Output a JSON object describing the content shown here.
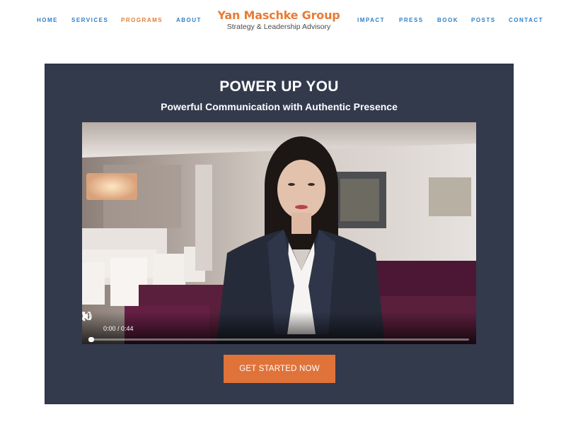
{
  "header": {
    "logo_title": "Yan Maschke Group",
    "logo_subtitle": "Strategy & Leadership Advisory",
    "nav_left": [
      {
        "label": "HOME"
      },
      {
        "label": "SERVICES"
      },
      {
        "label": "PROGRAMS",
        "active": true
      },
      {
        "label": "ABOUT"
      }
    ],
    "nav_right": [
      {
        "label": "IMPACT"
      },
      {
        "label": "PRESS"
      },
      {
        "label": "BOOK"
      },
      {
        "label": "POSTS"
      },
      {
        "label": "CONTACT"
      }
    ]
  },
  "hero": {
    "title": "POWER UP YOU",
    "subtitle": "Powerful Communication with Authentic Presence",
    "video": {
      "time_display": "0:00 / 0:44",
      "progress": 0,
      "icons": [
        "play-icon",
        "volume-icon",
        "fullscreen-icon",
        "more-options-icon"
      ]
    },
    "cta_label": "GET STARTED NOW"
  },
  "colors": {
    "nav": "#2d7fc4",
    "nav_active": "#e87b33",
    "brand": "#e87b33",
    "hero_bg": "#323a4c",
    "cta_bg": "#e0733a"
  }
}
